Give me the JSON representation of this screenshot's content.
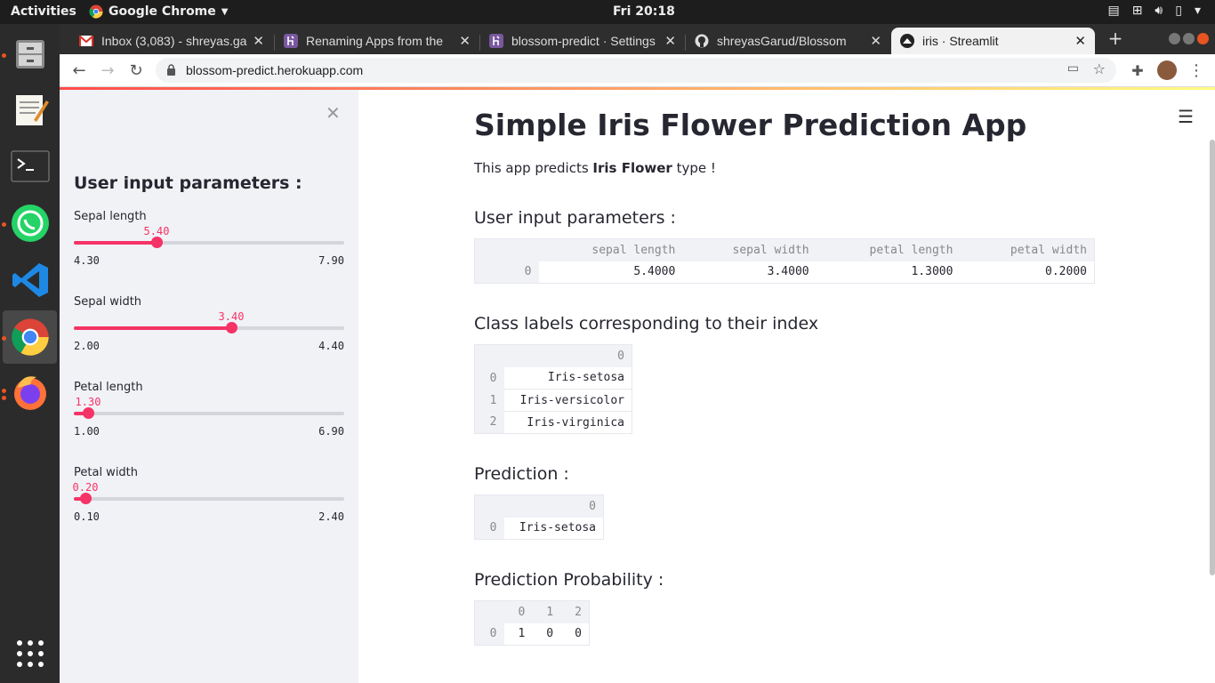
{
  "topbar": {
    "activities": "Activities",
    "app_name": "Google Chrome",
    "clock": "Fri 20:18"
  },
  "tabs": [
    {
      "title": "Inbox (3,083) - shreyas.ga",
      "icon": "gmail-icon",
      "active": false
    },
    {
      "title": "Renaming Apps from the",
      "icon": "heroku-icon",
      "active": false
    },
    {
      "title": "blossom-predict · Settings",
      "icon": "heroku-icon",
      "active": false
    },
    {
      "title": "shreyasGarud/Blossom",
      "icon": "github-icon",
      "active": false
    },
    {
      "title": "iris · Streamlit",
      "icon": "streamlit-icon",
      "active": true
    }
  ],
  "address": {
    "url": "blossom-predict.herokuapp.com"
  },
  "sidebar": {
    "title": "User input parameters :",
    "sliders": [
      {
        "label": "Sepal length",
        "value": "5.40",
        "min": "4.30",
        "max": "7.90",
        "fraction": 0.306
      },
      {
        "label": "Sepal width",
        "value": "3.40",
        "min": "2.00",
        "max": "4.40",
        "fraction": 0.583
      },
      {
        "label": "Petal length",
        "value": "1.30",
        "min": "1.00",
        "max": "6.90",
        "fraction": 0.051
      },
      {
        "label": "Petal width",
        "value": "0.20",
        "min": "0.10",
        "max": "2.40",
        "fraction": 0.043
      }
    ]
  },
  "main": {
    "title": "Simple Iris Flower Prediction App",
    "intro_prefix": "This app predicts ",
    "intro_bold": "Iris Flower",
    "intro_suffix": " type !",
    "sections": {
      "params": "User input parameters :",
      "labels": "Class labels corresponding to their index",
      "prediction": "Prediction :",
      "probability": "Prediction Probability :"
    },
    "params_table": {
      "columns": [
        "sepal length",
        "sepal width",
        "petal length",
        "petal width"
      ],
      "index": "0",
      "values": [
        "5.4000",
        "3.4000",
        "1.3000",
        "0.2000"
      ]
    },
    "labels_table": {
      "column": "0",
      "rows": [
        {
          "index": "0",
          "value": "Iris-setosa"
        },
        {
          "index": "1",
          "value": "Iris-versicolor"
        },
        {
          "index": "2",
          "value": "Iris-virginica"
        }
      ]
    },
    "prediction_table": {
      "column": "0",
      "index": "0",
      "value": "Iris-setosa"
    },
    "probability_table": {
      "columns": [
        "0",
        "1",
        "2"
      ],
      "index": "0",
      "values": [
        "1",
        "0",
        "0"
      ]
    }
  }
}
